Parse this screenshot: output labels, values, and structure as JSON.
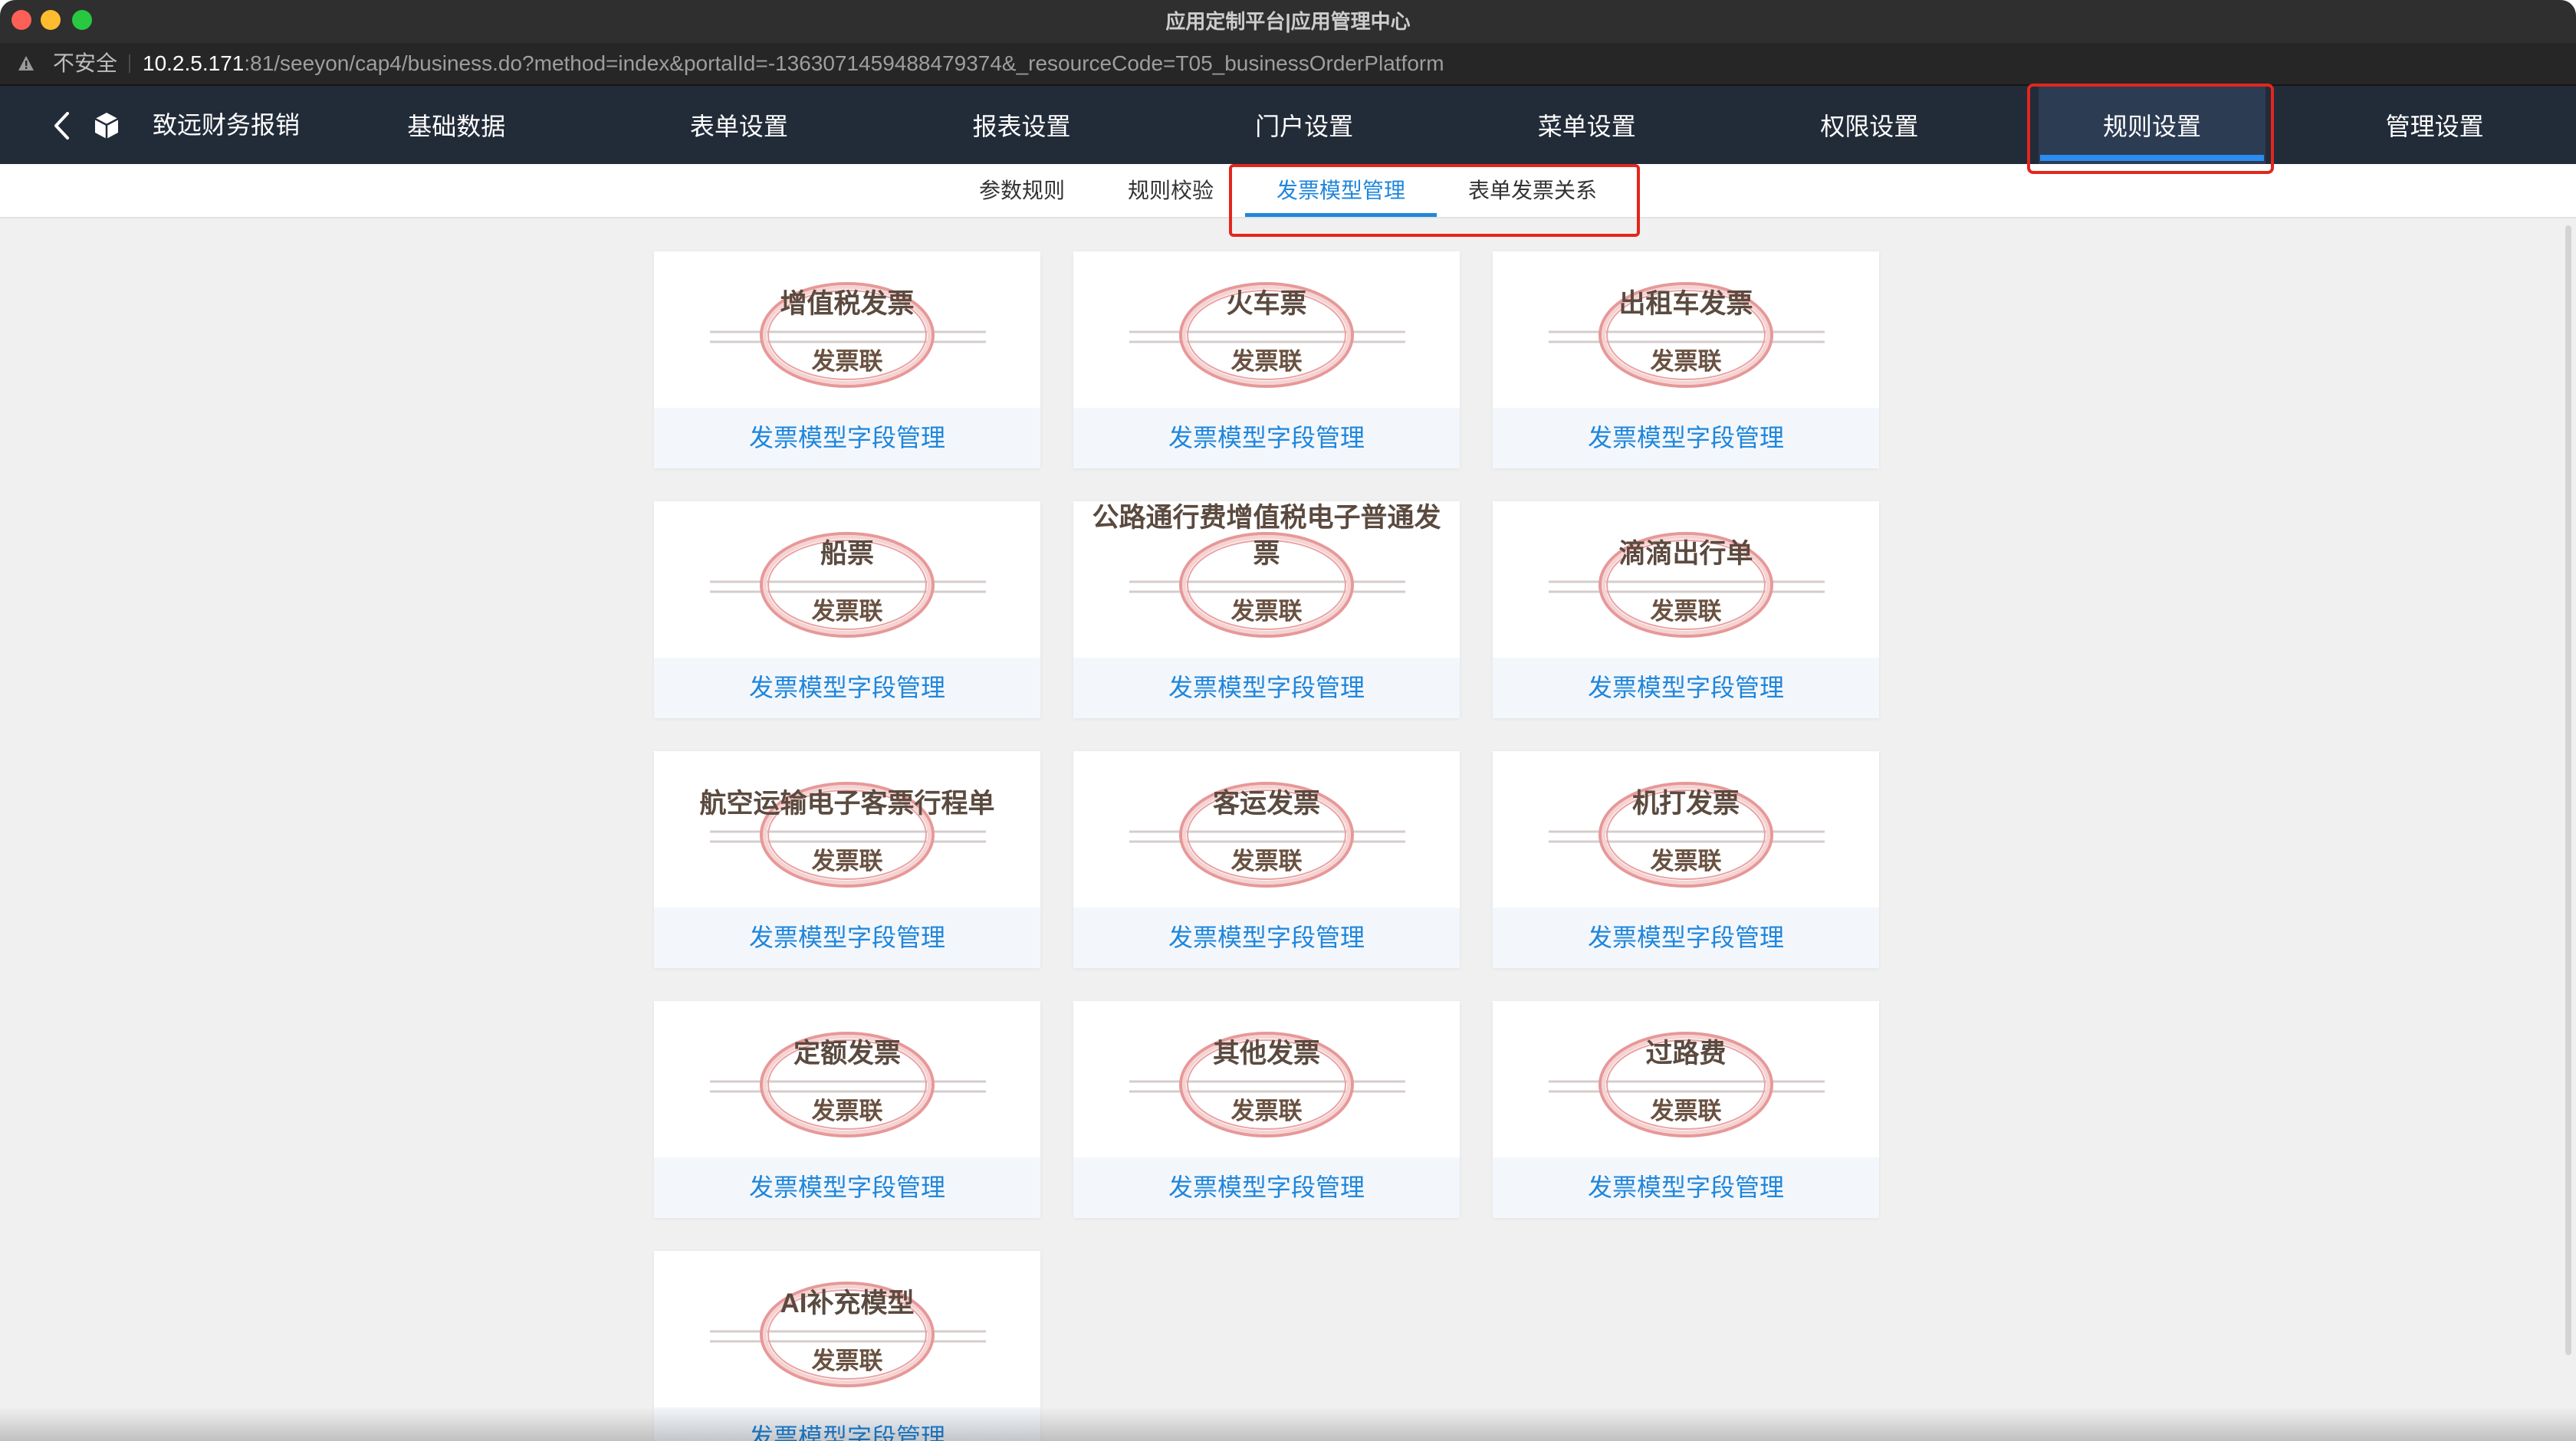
{
  "window": {
    "title": "应用定制平台|应用管理中心"
  },
  "address_bar": {
    "security_icon": "warning-triangle-icon",
    "security_label": "不安全",
    "url_host": "10.2.5.171",
    "url_path": ":81/seeyon/cap4/business.do?method=index&portalId=-1363071459488479374&_resourceCode=T05_businessOrderPlatform"
  },
  "nav": {
    "back_icon": "chevron-left-icon",
    "logo_icon": "cube-icon",
    "app_name": "致远财务报销",
    "items": [
      {
        "label": "基础数据"
      },
      {
        "label": "表单设置"
      },
      {
        "label": "报表设置"
      },
      {
        "label": "门户设置"
      },
      {
        "label": "菜单设置"
      },
      {
        "label": "权限设置"
      },
      {
        "label": "规则设置",
        "selected": true
      },
      {
        "label": "管理设置"
      }
    ]
  },
  "sub_tabs": {
    "items": [
      {
        "label": "参数规则"
      },
      {
        "label": "规则校验"
      },
      {
        "label": "发票模型管理",
        "selected": true
      },
      {
        "label": "表单发票关系"
      }
    ]
  },
  "invoice_models": [
    {
      "title": "增值税发票",
      "stamp_label": "发票联",
      "action_label": "发票模型字段管理"
    },
    {
      "title": "火车票",
      "stamp_label": "发票联",
      "action_label": "发票模型字段管理"
    },
    {
      "title": "出租车发票",
      "stamp_label": "发票联",
      "action_label": "发票模型字段管理"
    },
    {
      "title": "船票",
      "stamp_label": "发票联",
      "action_label": "发票模型字段管理"
    },
    {
      "title": "公路通行费增值税电子普通发票",
      "stamp_label": "发票联",
      "action_label": "发票模型字段管理"
    },
    {
      "title": "滴滴出行单",
      "stamp_label": "发票联",
      "action_label": "发票模型字段管理"
    },
    {
      "title": "航空运输电子客票行程单",
      "stamp_label": "发票联",
      "action_label": "发票模型字段管理"
    },
    {
      "title": "客运发票",
      "stamp_label": "发票联",
      "action_label": "发票模型字段管理"
    },
    {
      "title": "机打发票",
      "stamp_label": "发票联",
      "action_label": "发票模型字段管理"
    },
    {
      "title": "定额发票",
      "stamp_label": "发票联",
      "action_label": "发票模型字段管理"
    },
    {
      "title": "其他发票",
      "stamp_label": "发票联",
      "action_label": "发票模型字段管理"
    },
    {
      "title": "过路费",
      "stamp_label": "发票联",
      "action_label": "发票模型字段管理"
    },
    {
      "title": "AI补充模型",
      "stamp_label": "发票联",
      "action_label": "发票模型字段管理"
    }
  ],
  "theme": {
    "nav_background": "#222b38",
    "nav_active_background": "#2c3c53",
    "accent_blue": "#1f86dc",
    "annotation_red": "#e3261e",
    "content_background": "#f0f0f0"
  }
}
